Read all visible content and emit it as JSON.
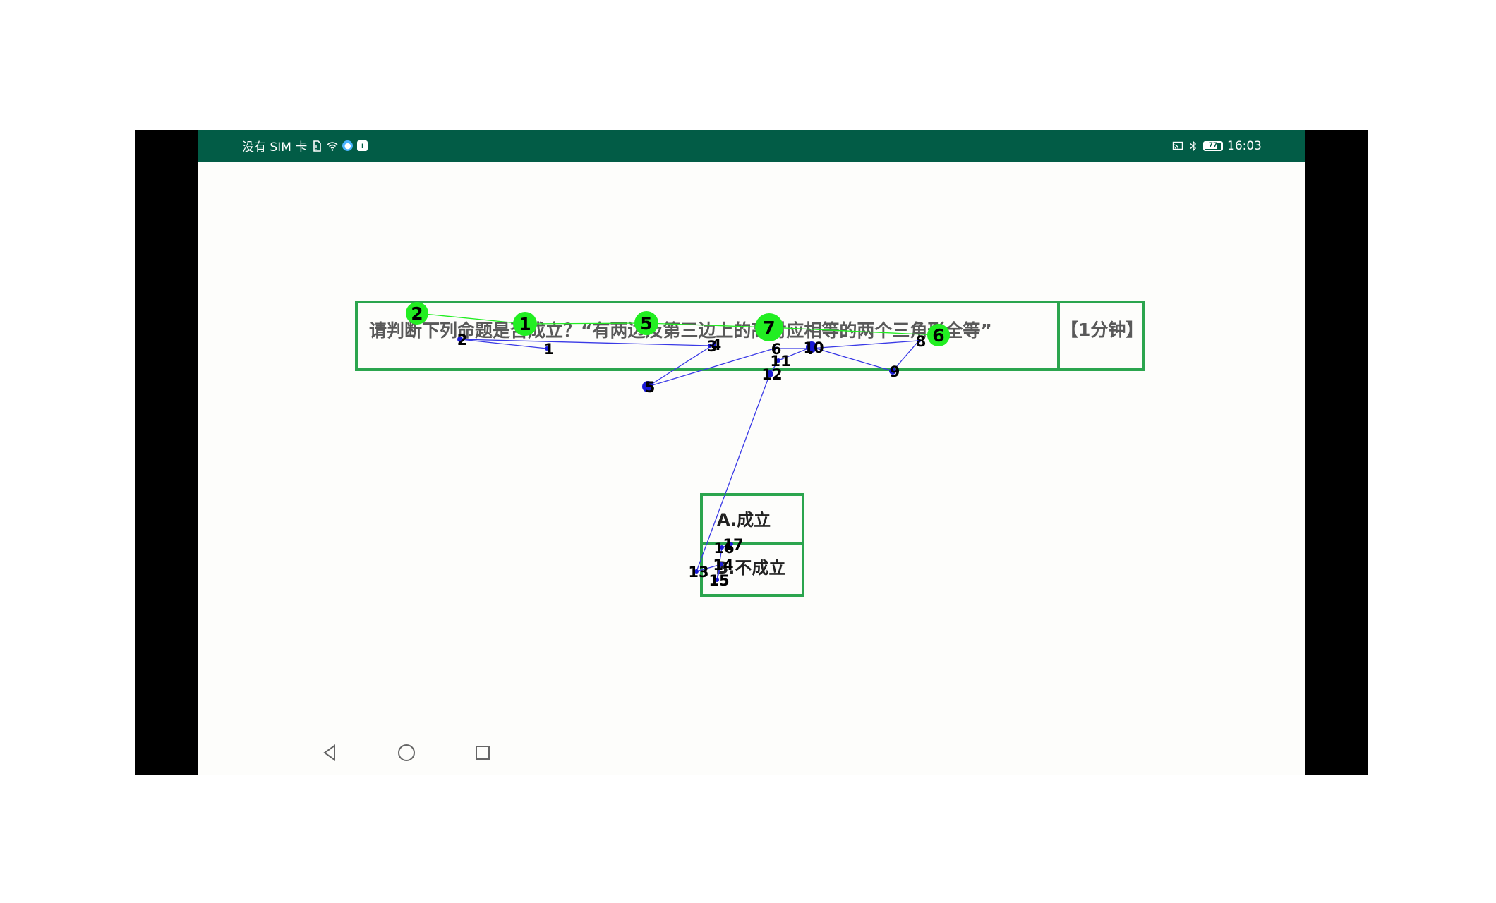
{
  "status_bar": {
    "left_text": "没有 SIM 卡",
    "time": "16:03",
    "battery_level": "77",
    "colors": {
      "background": "#025c46",
      "text": "#ffffff"
    },
    "icons": [
      "sim-icon",
      "wifi-icon",
      "app-badge-icon",
      "notification-icon",
      "cast-icon",
      "bluetooth-icon",
      "battery-icon"
    ]
  },
  "quiz": {
    "question": "请判断下列命题是否成立？“有两边及第三边上的高对应相等的两个三角形全等”",
    "timer": "【1分钟】",
    "options": [
      {
        "label": "A.成立"
      },
      {
        "label": "B.不成立"
      }
    ]
  },
  "nav_bar": {
    "icons": [
      "back-icon",
      "home-icon",
      "recents-icon"
    ]
  },
  "overlay": {
    "colors": {
      "box": "#2ba54e",
      "green_marker": "#22ee22",
      "blue_marker": "#1a1ad6",
      "blue_path": "#3a3ae6"
    },
    "green_markers": [
      "2",
      "1",
      "5",
      "7",
      "6"
    ],
    "blue_markers": [
      "1",
      "2",
      "3",
      "4",
      "5",
      "6",
      "7",
      "8",
      "9",
      "10",
      "11",
      "12",
      "13",
      "14",
      "15",
      "16",
      "17"
    ]
  }
}
